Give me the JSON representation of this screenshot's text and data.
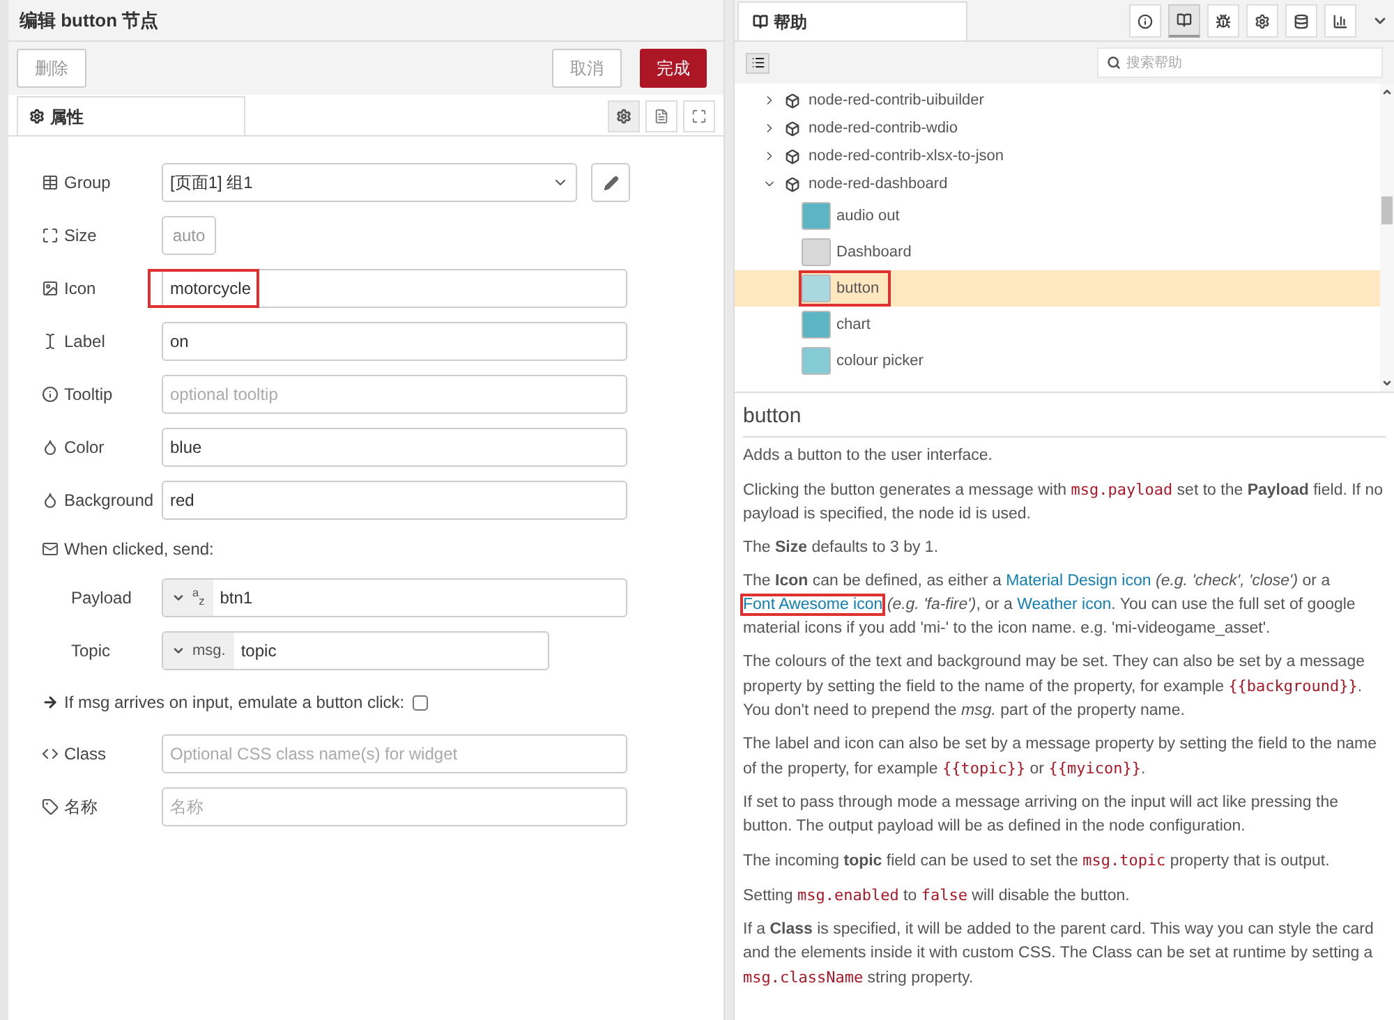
{
  "editor": {
    "title": "编辑 button 节点",
    "delete_button": "删除",
    "cancel_button": "取消",
    "done_button": "完成",
    "tab": {
      "label": "属性",
      "selected": true
    },
    "fields": [
      {
        "kind": "select",
        "label": "Group",
        "value": "[页面1] 组1"
      },
      {
        "kind": "size",
        "label": "Size",
        "value": "auto"
      },
      {
        "kind": "text",
        "label": "Icon",
        "value": "motorcycle",
        "highlighted": true
      },
      {
        "kind": "text",
        "label": "Label",
        "value": "on",
        "highlighted": false
      },
      {
        "kind": "text",
        "label": "Tooltip",
        "placeholder": "optional tooltip",
        "highlighted": false
      },
      {
        "kind": "text",
        "label": "Color",
        "value": "blue",
        "highlighted": false
      },
      {
        "kind": "text",
        "label": "Background",
        "value": "red",
        "highlighted": false
      },
      {
        "kind": "heading",
        "label": "When clicked, send:"
      },
      {
        "kind": "typed",
        "label": "Payload",
        "type": "$^{a}$$_{z}$",
        "value": "btn1"
      },
      {
        "kind": "typed",
        "label": "Topic",
        "type": "msg.",
        "value": "topic"
      },
      {
        "kind": "checkbox",
        "label": "If msg arrives on input, emulate a button click:",
        "checked": false
      },
      {
        "kind": "text",
        "label": "Class",
        "placeholder": "Optional CSS class name(s) for widget",
        "highlighted": false
      },
      {
        "kind": "text",
        "label": "名称",
        "placeholder": "名称",
        "highlighted": false
      }
    ]
  },
  "help": {
    "tab": "帮助",
    "tools": [
      {
        "selected": false
      },
      {
        "selected": true
      },
      {
        "selected": false
      },
      {
        "selected": false
      },
      {
        "selected": false
      },
      {
        "selected": false
      }
    ],
    "search": {
      "placeholder": "搜索帮助"
    },
    "tree": [
      {
        "label": "node-red-contrib-uibuilder",
        "expanded": false
      },
      {
        "label": "node-red-contrib-wdio",
        "expanded": false
      },
      {
        "label": "node-red-contrib-xlsx-to-json",
        "expanded": false
      },
      {
        "label": "node-red-dashboard",
        "expanded": true,
        "children": [
          {
            "label": "audio out",
            "color": "#5bb5c2",
            "selected": false,
            "highlighted": false
          },
          {
            "label": "Dashboard",
            "color": "#d9d9d9",
            "selected": false,
            "highlighted": false
          },
          {
            "label": "button",
            "color": "#a9d8df",
            "selected": true,
            "highlighted": true
          },
          {
            "label": "chart",
            "color": "#5bb5c2",
            "selected": false,
            "highlighted": false
          },
          {
            "label": "colour picker",
            "color": "#84cbd5",
            "selected": false,
            "highlighted": false
          }
        ]
      }
    ],
    "heading": "button",
    "paragraphs": [
      [
        {
          "kind": "text",
          "text": "Adds a button to the user interface."
        }
      ],
      [
        {
          "kind": "text",
          "text": "Clicking the button generates a message with "
        },
        {
          "kind": "code",
          "text": "msg.payload"
        },
        {
          "kind": "text",
          "text": " set to the **Payload** field. If no payload is specified, the node id is used."
        }
      ],
      [
        {
          "kind": "text",
          "text": "The **Size** defaults to 3 by 1."
        }
      ],
      [
        {
          "kind": "text",
          "text": "The **Icon** can be defined, as either a "
        },
        {
          "kind": "link",
          "text": "Material Design icon",
          "highlighted": false
        },
        {
          "kind": "text",
          "text": " *(e.g. 'check', 'close')* or a "
        },
        {
          "kind": "link",
          "text": "Font Awesome icon",
          "highlighted": true
        },
        {
          "kind": "text",
          "text": " *(e.g. 'fa-fire')*, or a "
        },
        {
          "kind": "link",
          "text": "Weather icon",
          "highlighted": false
        },
        {
          "kind": "text",
          "text": ". You can use the full set of google material icons if you add 'mi-' to the icon name. e.g. 'mi-videogame_asset'."
        }
      ],
      [
        {
          "kind": "text",
          "text": "The colours of the text and background may be set. They can also be set by a message property by setting the field to the name of the property, for example "
        },
        {
          "kind": "code",
          "text": "{{background}}"
        },
        {
          "kind": "text",
          "text": ". You don't need to prepend the *msg.* part of the property name."
        }
      ],
      [
        {
          "kind": "text",
          "text": "The label and icon can also be set by a message property by setting the field to the name of the property, for example "
        },
        {
          "kind": "code",
          "text": "{{topic}}"
        },
        {
          "kind": "text",
          "text": " or "
        },
        {
          "kind": "code",
          "text": "{{myicon}}"
        },
        {
          "kind": "text",
          "text": "."
        }
      ],
      [
        {
          "kind": "text",
          "text": "If set to pass through mode a message arriving on the input will act like pressing the button. The output payload will be as defined in the node configuration."
        }
      ],
      [
        {
          "kind": "text",
          "text": "The incoming **topic** field can be used to set the "
        },
        {
          "kind": "code",
          "text": "msg.topic"
        },
        {
          "kind": "text",
          "text": " property that is output."
        }
      ],
      [
        {
          "kind": "text",
          "text": "Setting "
        },
        {
          "kind": "code",
          "text": "msg.enabled"
        },
        {
          "kind": "text",
          "text": " to "
        },
        {
          "kind": "code",
          "text": "false"
        },
        {
          "kind": "text",
          "text": " will disable the button."
        }
      ],
      [
        {
          "kind": "text",
          "text": "If a **Class** is specified, it will be added to the parent card. This way you can style the card and the elements inside it with custom CSS. The Class can be set at runtime by setting a "
        },
        {
          "kind": "code",
          "text": "msg.className"
        },
        {
          "kind": "text",
          "text": " string property."
        }
      ]
    ]
  }
}
